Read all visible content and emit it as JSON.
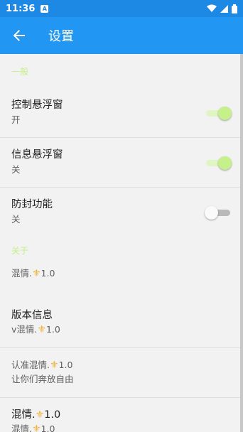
{
  "status_bar": {
    "time": "11:36",
    "notification_icon": "A"
  },
  "app_bar": {
    "title": "设置"
  },
  "sections": {
    "general": "一般",
    "about": "关于"
  },
  "prefs": [
    {
      "title": "控制悬浮窗",
      "summary": "开",
      "switch_on": true
    },
    {
      "title": "信息悬浮窗",
      "summary": "关",
      "switch_on": true
    },
    {
      "title": "防封功能",
      "summary": "关",
      "switch_on": false
    }
  ],
  "about": {
    "app_name_prefix": "混情.",
    "version": "1.0",
    "version_info_title": "版本信息",
    "version_info_prefix": "v混情.",
    "recognize_prefix": "认准混情.",
    "slogan": "让你们奔放自由",
    "bottom_title_prefix": "混情.",
    "bottom_summary_prefix": "混情."
  },
  "colors": {
    "status_bar": "#1e88e5",
    "app_bar": "#2196f3",
    "accent": "#c5f08a",
    "icon_fleur": "#f2b233"
  },
  "icons": {
    "back": "arrow-left-icon",
    "wifi": "wifi-icon",
    "signal": "cell-signal-icon",
    "battery": "battery-icon",
    "emoji": "fleur-de-lis-icon"
  }
}
